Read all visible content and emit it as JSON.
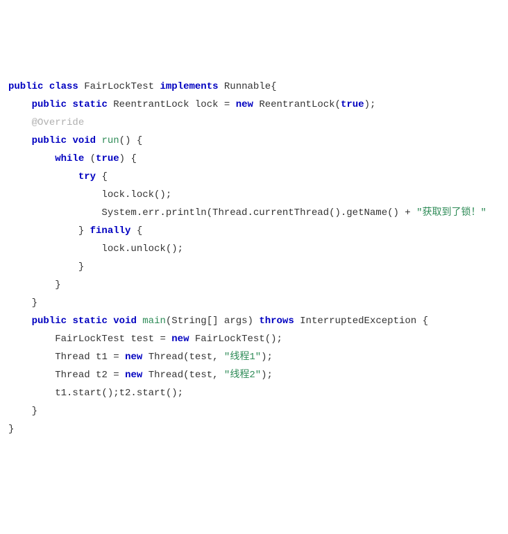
{
  "code": {
    "lines": [
      {
        "segments": [
          {
            "cls": "kw",
            "t": "public"
          },
          {
            "cls": "plain",
            "t": " "
          },
          {
            "cls": "kw",
            "t": "class"
          },
          {
            "cls": "plain",
            "t": " "
          },
          {
            "cls": "cls",
            "t": "FairLockTest"
          },
          {
            "cls": "plain",
            "t": " "
          },
          {
            "cls": "kw",
            "t": "implements"
          },
          {
            "cls": "plain",
            "t": " "
          },
          {
            "cls": "cls",
            "t": "Runnable"
          },
          {
            "cls": "plain",
            "t": "{"
          }
        ]
      },
      {
        "segments": [
          {
            "cls": "plain",
            "t": "    "
          },
          {
            "cls": "kw",
            "t": "public"
          },
          {
            "cls": "plain",
            "t": " "
          },
          {
            "cls": "kw",
            "t": "static"
          },
          {
            "cls": "plain",
            "t": " "
          },
          {
            "cls": "cls",
            "t": "ReentrantLock"
          },
          {
            "cls": "plain",
            "t": " lock = "
          },
          {
            "cls": "kw",
            "t": "new"
          },
          {
            "cls": "plain",
            "t": " "
          },
          {
            "cls": "cls",
            "t": "ReentrantLock"
          },
          {
            "cls": "plain",
            "t": "("
          },
          {
            "cls": "kw",
            "t": "true"
          },
          {
            "cls": "plain",
            "t": ");"
          }
        ]
      },
      {
        "segments": [
          {
            "cls": "plain",
            "t": ""
          }
        ]
      },
      {
        "segments": [
          {
            "cls": "plain",
            "t": "    "
          },
          {
            "cls": "ann",
            "t": "@Override"
          }
        ]
      },
      {
        "segments": [
          {
            "cls": "plain",
            "t": "    "
          },
          {
            "cls": "kw",
            "t": "public"
          },
          {
            "cls": "plain",
            "t": " "
          },
          {
            "cls": "kw",
            "t": "void"
          },
          {
            "cls": "plain",
            "t": " "
          },
          {
            "cls": "mname",
            "t": "run"
          },
          {
            "cls": "plain",
            "t": "() {"
          }
        ]
      },
      {
        "segments": [
          {
            "cls": "plain",
            "t": "        "
          },
          {
            "cls": "kw",
            "t": "while"
          },
          {
            "cls": "plain",
            "t": " ("
          },
          {
            "cls": "kw",
            "t": "true"
          },
          {
            "cls": "plain",
            "t": ") {"
          }
        ]
      },
      {
        "segments": [
          {
            "cls": "plain",
            "t": "            "
          },
          {
            "cls": "kw",
            "t": "try"
          },
          {
            "cls": "plain",
            "t": " {"
          }
        ]
      },
      {
        "segments": [
          {
            "cls": "plain",
            "t": "                lock.lock();"
          }
        ]
      },
      {
        "segments": [
          {
            "cls": "plain",
            "t": "                System.err.println(Thread.currentThread().getName() + "
          },
          {
            "cls": "str",
            "t": "\"获取到了锁！\""
          }
        ]
      },
      {
        "segments": [
          {
            "cls": "plain",
            "t": "            } "
          },
          {
            "cls": "kw",
            "t": "finally"
          },
          {
            "cls": "plain",
            "t": " {"
          }
        ]
      },
      {
        "segments": [
          {
            "cls": "plain",
            "t": "                lock.unlock();"
          }
        ]
      },
      {
        "segments": [
          {
            "cls": "plain",
            "t": "            }"
          }
        ]
      },
      {
        "segments": [
          {
            "cls": "plain",
            "t": "        }"
          }
        ]
      },
      {
        "segments": [
          {
            "cls": "plain",
            "t": "    }"
          }
        ]
      },
      {
        "segments": [
          {
            "cls": "plain",
            "t": ""
          }
        ]
      },
      {
        "segments": [
          {
            "cls": "plain",
            "t": "    "
          },
          {
            "cls": "kw",
            "t": "public"
          },
          {
            "cls": "plain",
            "t": " "
          },
          {
            "cls": "kw",
            "t": "static"
          },
          {
            "cls": "plain",
            "t": " "
          },
          {
            "cls": "kw",
            "t": "void"
          },
          {
            "cls": "plain",
            "t": " "
          },
          {
            "cls": "mname",
            "t": "main"
          },
          {
            "cls": "plain",
            "t": "(String[] args) "
          },
          {
            "cls": "kw",
            "t": "throws"
          },
          {
            "cls": "plain",
            "t": " "
          },
          {
            "cls": "cls",
            "t": "InterruptedException"
          },
          {
            "cls": "plain",
            "t": " {"
          }
        ]
      },
      {
        "segments": [
          {
            "cls": "plain",
            "t": "        "
          },
          {
            "cls": "cls",
            "t": "FairLockTest"
          },
          {
            "cls": "plain",
            "t": " test = "
          },
          {
            "cls": "kw",
            "t": "new"
          },
          {
            "cls": "plain",
            "t": " "
          },
          {
            "cls": "cls",
            "t": "FairLockTest"
          },
          {
            "cls": "plain",
            "t": "();"
          }
        ]
      },
      {
        "segments": [
          {
            "cls": "plain",
            "t": "        "
          },
          {
            "cls": "cls",
            "t": "Thread"
          },
          {
            "cls": "plain",
            "t": " t1 = "
          },
          {
            "cls": "kw",
            "t": "new"
          },
          {
            "cls": "plain",
            "t": " "
          },
          {
            "cls": "cls",
            "t": "Thread"
          },
          {
            "cls": "plain",
            "t": "(test, "
          },
          {
            "cls": "str",
            "t": "\"线程1\""
          },
          {
            "cls": "plain",
            "t": ");"
          }
        ]
      },
      {
        "segments": [
          {
            "cls": "plain",
            "t": "        "
          },
          {
            "cls": "cls",
            "t": "Thread"
          },
          {
            "cls": "plain",
            "t": " t2 = "
          },
          {
            "cls": "kw",
            "t": "new"
          },
          {
            "cls": "plain",
            "t": " "
          },
          {
            "cls": "cls",
            "t": "Thread"
          },
          {
            "cls": "plain",
            "t": "(test, "
          },
          {
            "cls": "str",
            "t": "\"线程2\""
          },
          {
            "cls": "plain",
            "t": ");"
          }
        ]
      },
      {
        "segments": [
          {
            "cls": "plain",
            "t": "        t1.start();t2.start();"
          }
        ]
      },
      {
        "segments": [
          {
            "cls": "plain",
            "t": "    }"
          }
        ]
      },
      {
        "segments": [
          {
            "cls": "plain",
            "t": "}"
          }
        ]
      }
    ]
  }
}
